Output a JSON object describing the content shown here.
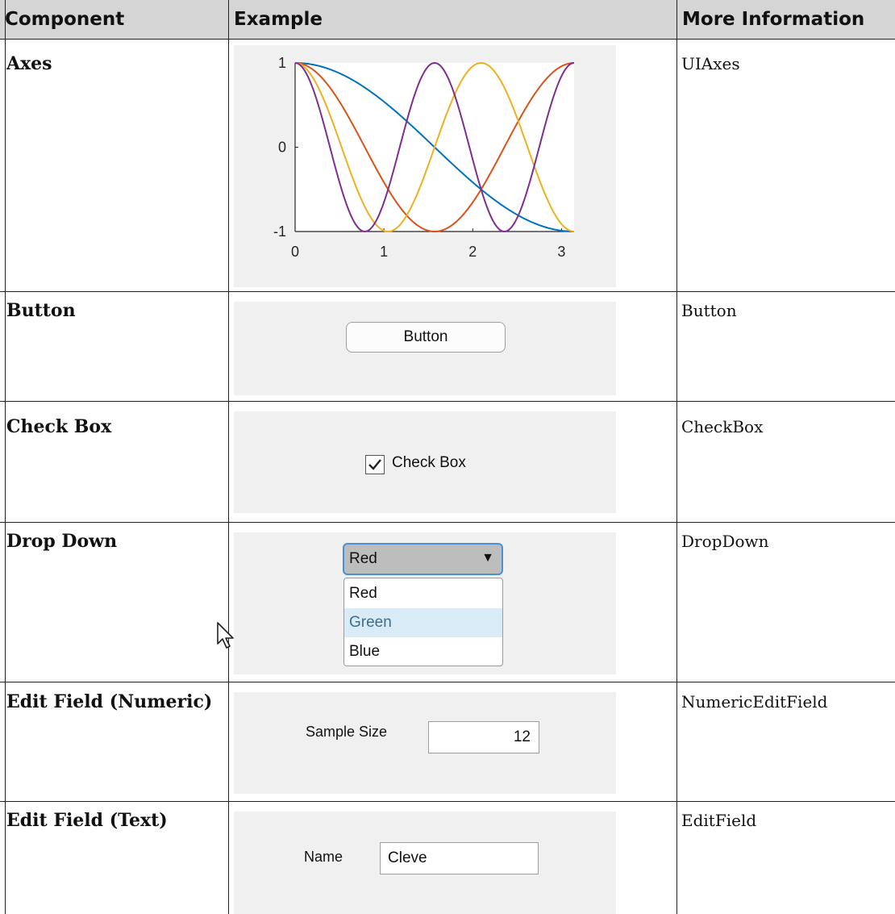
{
  "table": {
    "headers": {
      "component": "Component",
      "example": "Example",
      "more_info": "More Information"
    },
    "rows": [
      {
        "component": "Axes",
        "more_info": "UIAxes"
      },
      {
        "component": "Button",
        "more_info": "Button"
      },
      {
        "component": "Check Box",
        "more_info": "CheckBox"
      },
      {
        "component": "Drop Down",
        "more_info": "DropDown"
      },
      {
        "component": "Edit Field (Numeric)",
        "more_info": "NumericEditField"
      },
      {
        "component": "Edit Field (Text)",
        "more_info": "EditField"
      }
    ]
  },
  "examples": {
    "axes": {
      "x_ticks": [
        "0",
        "1",
        "2",
        "3"
      ],
      "y_ticks": [
        "1",
        "0",
        "-1"
      ]
    },
    "button": {
      "label": "Button"
    },
    "checkbox": {
      "label": "Check Box",
      "checked": true
    },
    "dropdown": {
      "selected": "Red",
      "options": [
        "Red",
        "Green",
        "Blue"
      ],
      "highlighted": "Green"
    },
    "numeric_field": {
      "label": "Sample Size",
      "value": "12"
    },
    "text_field": {
      "label": "Name",
      "value": "Cleve"
    }
  },
  "chart_data": {
    "type": "line",
    "xlim": [
      0,
      3.14159
    ],
    "ylim": [
      -1,
      1
    ],
    "x_ticks": [
      0,
      1,
      2,
      3
    ],
    "y_ticks": [
      -1,
      0,
      1
    ],
    "series": [
      {
        "function": "cos(x)",
        "color": "#0072BD"
      },
      {
        "function": "cos(2x)",
        "color": "#D95319"
      },
      {
        "function": "cos(3x)",
        "color": "#EDB120"
      },
      {
        "function": "cos(4x)",
        "color": "#7E2F8E"
      }
    ]
  }
}
